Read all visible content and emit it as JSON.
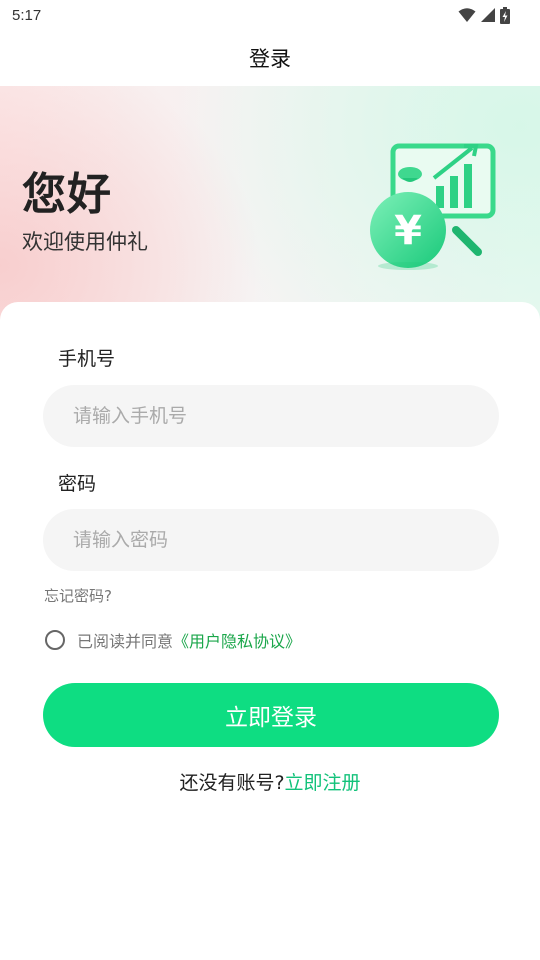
{
  "status_bar": {
    "time": "5:17",
    "icons": [
      "wifi-icon",
      "signal-icon",
      "battery-charging-icon"
    ]
  },
  "nav": {
    "title": "登录"
  },
  "hero": {
    "greeting": "您好",
    "subtitle": "欢迎使用仲礼",
    "illustration": "money-bag-chart-icon"
  },
  "form": {
    "phone_label": "手机号",
    "phone_placeholder": "请输入手机号",
    "password_label": "密码",
    "password_placeholder": "请输入密码",
    "forgot_password": "忘记密码?",
    "agreement_prefix": "已阅读并同意",
    "agreement_link": "《用户隐私协议》",
    "agreement_checked": false,
    "login_button": "立即登录",
    "register_prompt": "还没有账号?",
    "register_link": "立即注册"
  },
  "colors": {
    "primary_green": "#0edd82",
    "link_green": "#1aa64a",
    "register_green": "#12c27a",
    "input_bg": "#f5f5f5"
  }
}
